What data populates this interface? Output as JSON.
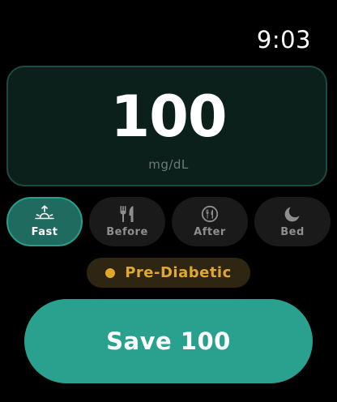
{
  "status_bar": {
    "time": "9:03"
  },
  "reading": {
    "value": "100",
    "unit": "mg/dL"
  },
  "contexts": [
    {
      "label": "Fast",
      "icon": "sunrise-icon",
      "selected": true
    },
    {
      "label": "Before",
      "icon": "fork-knife-icon",
      "selected": false
    },
    {
      "label": "After",
      "icon": "fork-knife-circle-icon",
      "selected": false
    },
    {
      "label": "Bed",
      "icon": "moon-icon",
      "selected": false
    }
  ],
  "status": {
    "label": "Pre-Diabetic",
    "color": "#e0a82e"
  },
  "save_button": {
    "label": "Save 100"
  },
  "colors": {
    "accent": "#2aa08e",
    "selected_context": "#1f6b5f",
    "card_background": "#0b1f1b",
    "warning": "#e0a82e"
  }
}
